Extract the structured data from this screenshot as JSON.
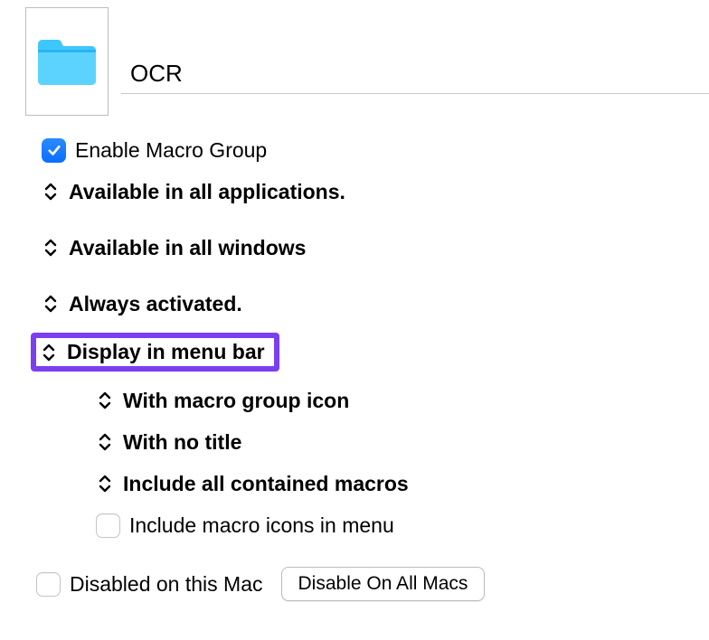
{
  "header": {
    "title_value": "OCR"
  },
  "enable": {
    "label": "Enable Macro Group",
    "checked": true
  },
  "options": {
    "available_apps": "Available in all applications.",
    "available_windows": "Available in all windows",
    "always_activated": "Always activated.",
    "display_menu_bar": "Display in menu bar"
  },
  "subopts": {
    "with_icon": "With macro group icon",
    "with_no_title": "With no title",
    "include_macros": "Include all contained macros",
    "include_icons": "Include macro icons in menu",
    "include_icons_checked": false
  },
  "footer": {
    "disabled_label": "Disabled on this Mac",
    "disabled_checked": false,
    "button_label": "Disable On All Macs"
  }
}
